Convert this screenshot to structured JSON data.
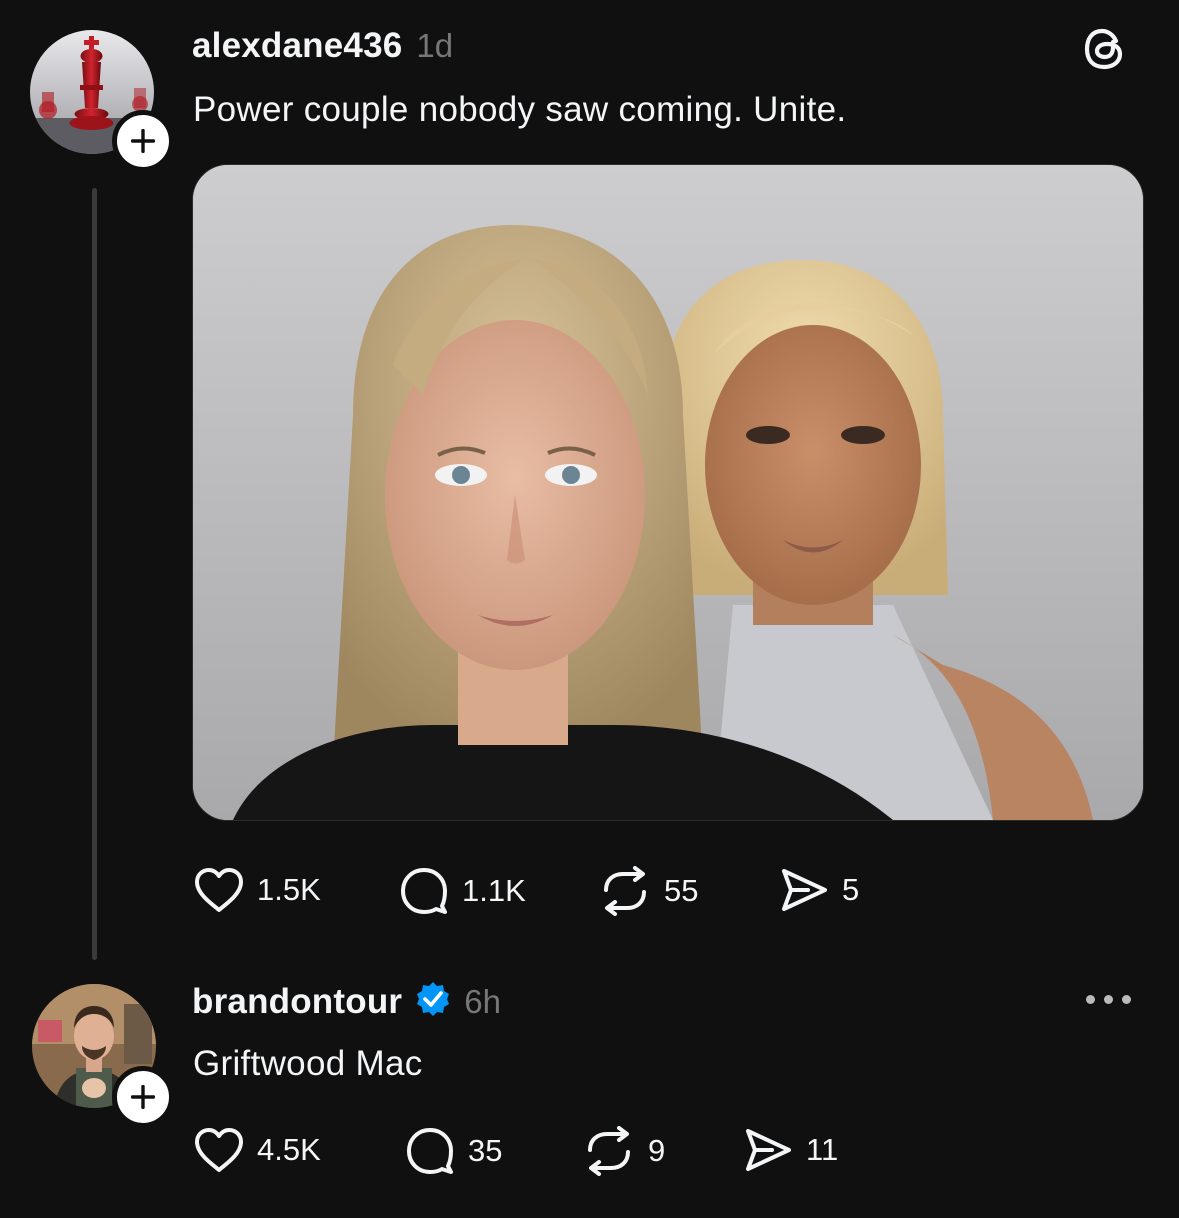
{
  "posts": [
    {
      "username": "alexdane436",
      "timestamp": "1d",
      "text": "Power couple nobody saw coming. Unite.",
      "avatar_icon": "chess-king-avatar",
      "verified": false,
      "actions": {
        "likes": "1.5K",
        "replies": "1.1K",
        "reposts": "55",
        "shares": "5"
      }
    },
    {
      "username": "brandontour",
      "timestamp": "6h",
      "text": "Griftwood Mac",
      "avatar_icon": "person-avatar",
      "verified": true,
      "actions": {
        "likes": "4.5K",
        "replies": "35",
        "reposts": "9",
        "shares": "11"
      }
    }
  ],
  "icons": {
    "app_logo": "threads-logo-icon",
    "like": "heart-icon",
    "reply": "comment-icon",
    "repost": "repost-icon",
    "share": "share-icon",
    "follow": "plus-icon",
    "more": "more-icon",
    "verified": "verified-badge-icon"
  },
  "colors": {
    "background": "#101010",
    "text": "#f3f5f7",
    "muted": "#777777",
    "verified": "#0095f6"
  }
}
